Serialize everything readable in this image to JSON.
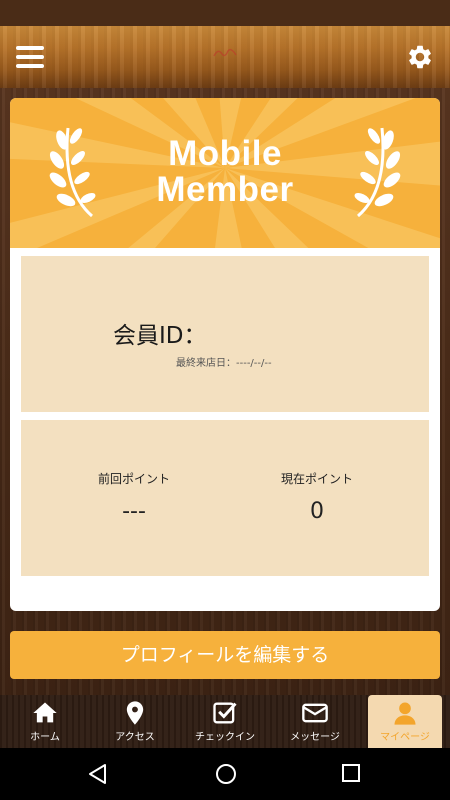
{
  "header": {
    "menu_icon": "hamburger-menu-icon",
    "settings_icon": "gear-icon",
    "logo_icon": "shop-logo-icon"
  },
  "banner": {
    "title_line1": "Mobile",
    "title_line2": "Member",
    "color": "#f6b13c",
    "icon": "laurel-icon"
  },
  "member": {
    "id_label": "会員ID：",
    "last_visit_label": "最終来店日：",
    "last_visit_value": "----/--/--"
  },
  "points": {
    "previous_label": "前回ポイント",
    "previous_value": "---",
    "current_label": "現在ポイント",
    "current_value": "0"
  },
  "edit_profile_label": "プロフィールを編集する",
  "tabs": [
    {
      "label": "ホーム",
      "icon": "home-icon"
    },
    {
      "label": "アクセス",
      "icon": "map-pin-icon"
    },
    {
      "label": "チェックイン",
      "icon": "checkbox-icon"
    },
    {
      "label": "メッセージ",
      "icon": "envelope-icon"
    },
    {
      "label": "マイページ",
      "icon": "user-icon",
      "active": true
    }
  ],
  "accent_color": "#f6b13c",
  "active_tab_label_color": "#f3a52c",
  "system_nav": {
    "back_icon": "back-triangle-icon",
    "home_icon": "home-circle-icon",
    "recents_icon": "recents-square-icon"
  }
}
